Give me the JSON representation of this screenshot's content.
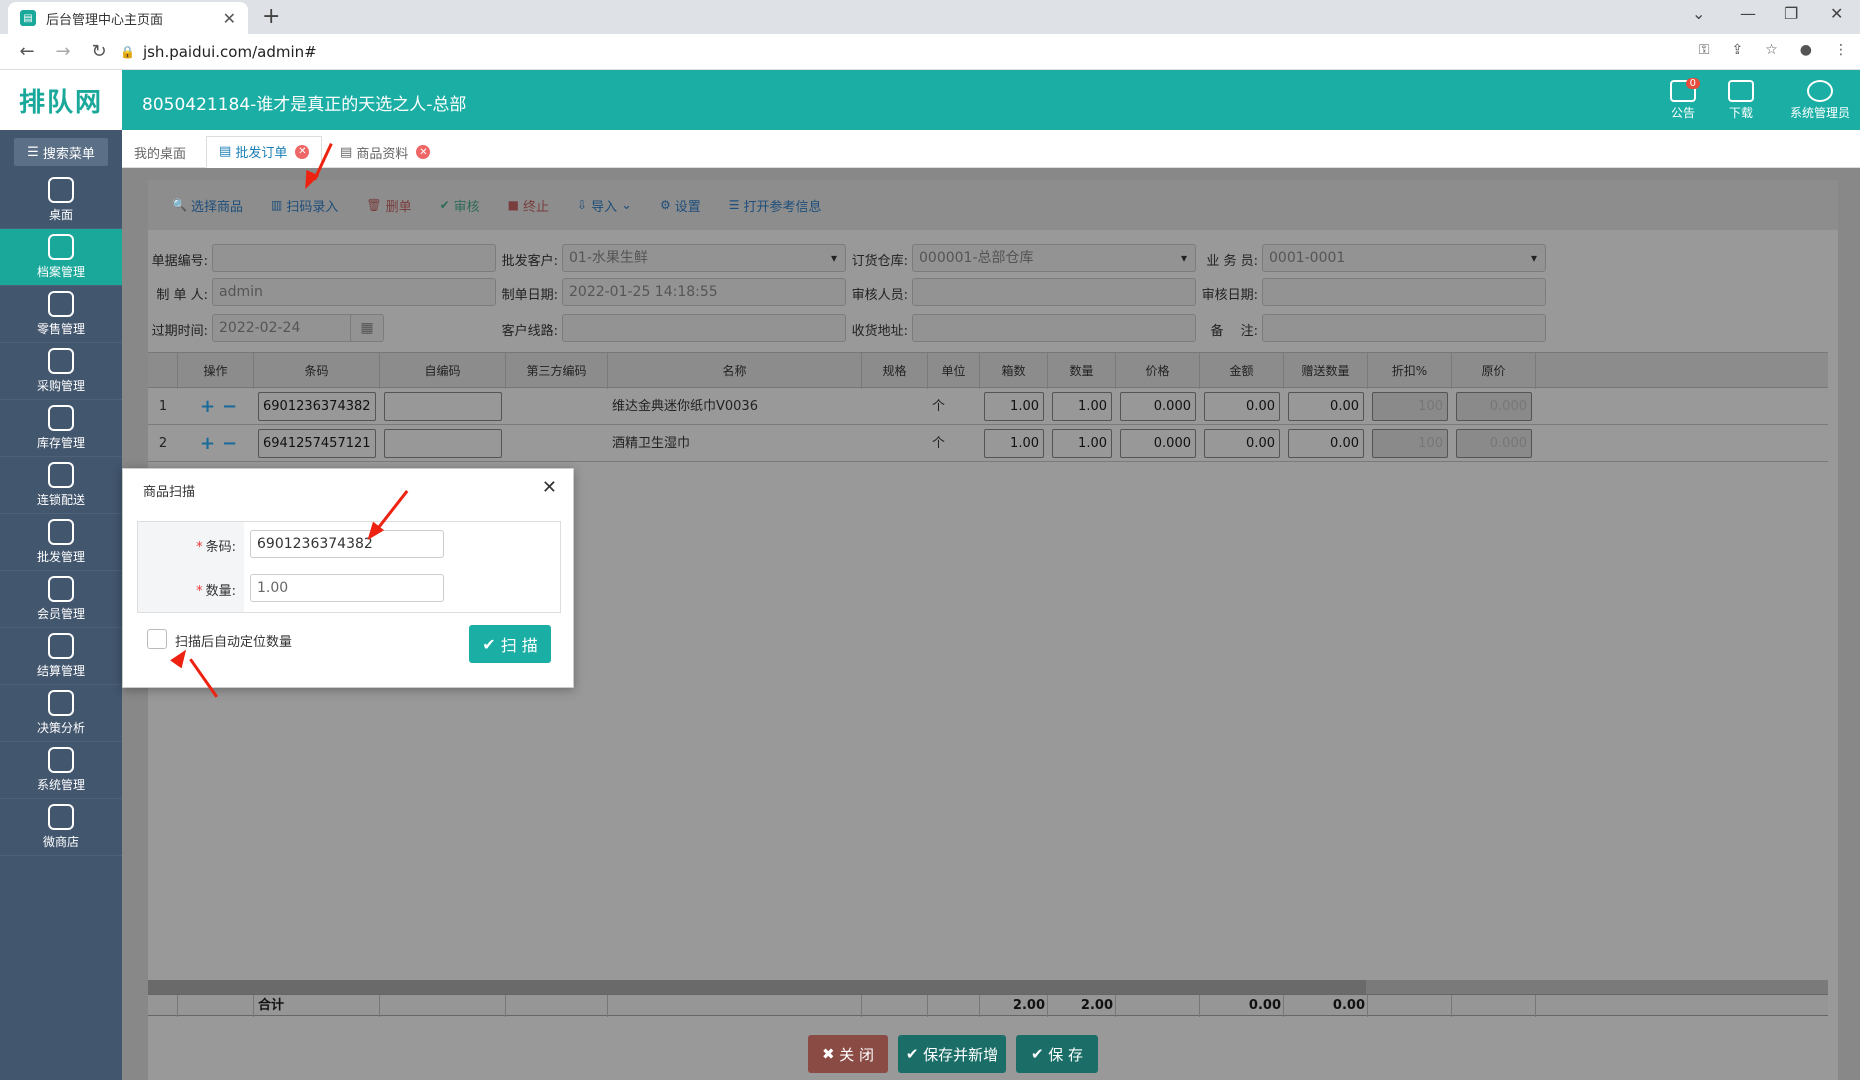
{
  "browser": {
    "tab_title": "后台管理中心主页面",
    "url": "jsh.paidui.com/admin#"
  },
  "sidebar": {
    "logo": "排队网",
    "search_menu": "搜索菜单",
    "items": [
      {
        "label": "桌面",
        "icon": "dashboard-icon"
      },
      {
        "label": "档案管理",
        "icon": "archive-icon",
        "active": true
      },
      {
        "label": "零售管理",
        "icon": "store-icon"
      },
      {
        "label": "采购管理",
        "icon": "purchase-icon"
      },
      {
        "label": "库存管理",
        "icon": "inventory-icon"
      },
      {
        "label": "连锁配送",
        "icon": "delivery-icon"
      },
      {
        "label": "批发管理",
        "icon": "wholesale-icon"
      },
      {
        "label": "会员管理",
        "icon": "member-icon"
      },
      {
        "label": "结算管理",
        "icon": "settlement-icon"
      },
      {
        "label": "决策分析",
        "icon": "analysis-icon"
      },
      {
        "label": "系统管理",
        "icon": "settings-icon"
      },
      {
        "label": "微商店",
        "icon": "shop-icon"
      }
    ]
  },
  "header": {
    "title": "8050421184-谁才是真正的天选之人-总部",
    "notice_label": "公告",
    "notice_count": "0",
    "download_label": "下载",
    "user_label": "系统管理员"
  },
  "page_tabs": [
    {
      "label": "我的桌面"
    },
    {
      "label": "批发订单",
      "active": true
    },
    {
      "label": "商品资料"
    }
  ],
  "toolbar": {
    "select_goods": "选择商品",
    "scan_entry": "扫码录入",
    "delete": "删单",
    "audit": "审核",
    "terminate": "终止",
    "import": "导入",
    "settings": "设置",
    "open_ref": "打开参考信息"
  },
  "form": {
    "doc_no_label": "单据编号:",
    "doc_no": "",
    "customer_label": "批发客户:",
    "customer": "01-水果生鲜",
    "warehouse_label": "订货仓库:",
    "warehouse": "000001-总部仓库",
    "salesman_label": "业 务 员:",
    "salesman": "0001-0001",
    "creator_label": "制 单 人:",
    "creator": "admin",
    "create_date_label": "制单日期:",
    "create_date": "2022-01-25 14:18:55",
    "auditor_label": "审核人员:",
    "auditor": "",
    "audit_date_label": "审核日期:",
    "audit_date": "",
    "expire_label": "过期时间:",
    "expire": "2022-02-24",
    "route_label": "客户线路:",
    "route": "",
    "address_label": "收货地址:",
    "address": "",
    "remark_label": "备　 注:",
    "remark": ""
  },
  "grid": {
    "columns": [
      "操作",
      "条码",
      "自编码",
      "第三方编码",
      "名称",
      "规格",
      "单位",
      "箱数",
      "数量",
      "价格",
      "金额",
      "赠送数量",
      "折扣%",
      "原价"
    ],
    "rows": [
      {
        "no": "1",
        "barcode": "6901236374382",
        "name": "维达金典迷你纸巾V0036",
        "unit": "个",
        "boxes": "1.00",
        "qty": "1.00",
        "price": "0.000",
        "amount": "0.00",
        "gift": "0.00",
        "discount": "100",
        "orig": "0.000"
      },
      {
        "no": "2",
        "barcode": "6941257457121",
        "name": "酒精卫生湿巾",
        "unit": "个",
        "boxes": "1.00",
        "qty": "1.00",
        "price": "0.000",
        "amount": "0.00",
        "gift": "0.00",
        "discount": "100",
        "orig": "0.000"
      }
    ],
    "total_label": "合计",
    "total_boxes": "2.00",
    "total_qty": "2.00",
    "total_amount": "0.00",
    "total_gift": "0.00"
  },
  "actions": {
    "close": "关 闭",
    "save_new": "保存并新增",
    "save": "保 存"
  },
  "modal": {
    "title": "商品扫描",
    "barcode_label": "条码:",
    "barcode": "6901236374382",
    "qty_label": "数量:",
    "qty": "1.00",
    "auto_locate": "扫描后自动定位数量",
    "scan_button": "扫 描"
  }
}
